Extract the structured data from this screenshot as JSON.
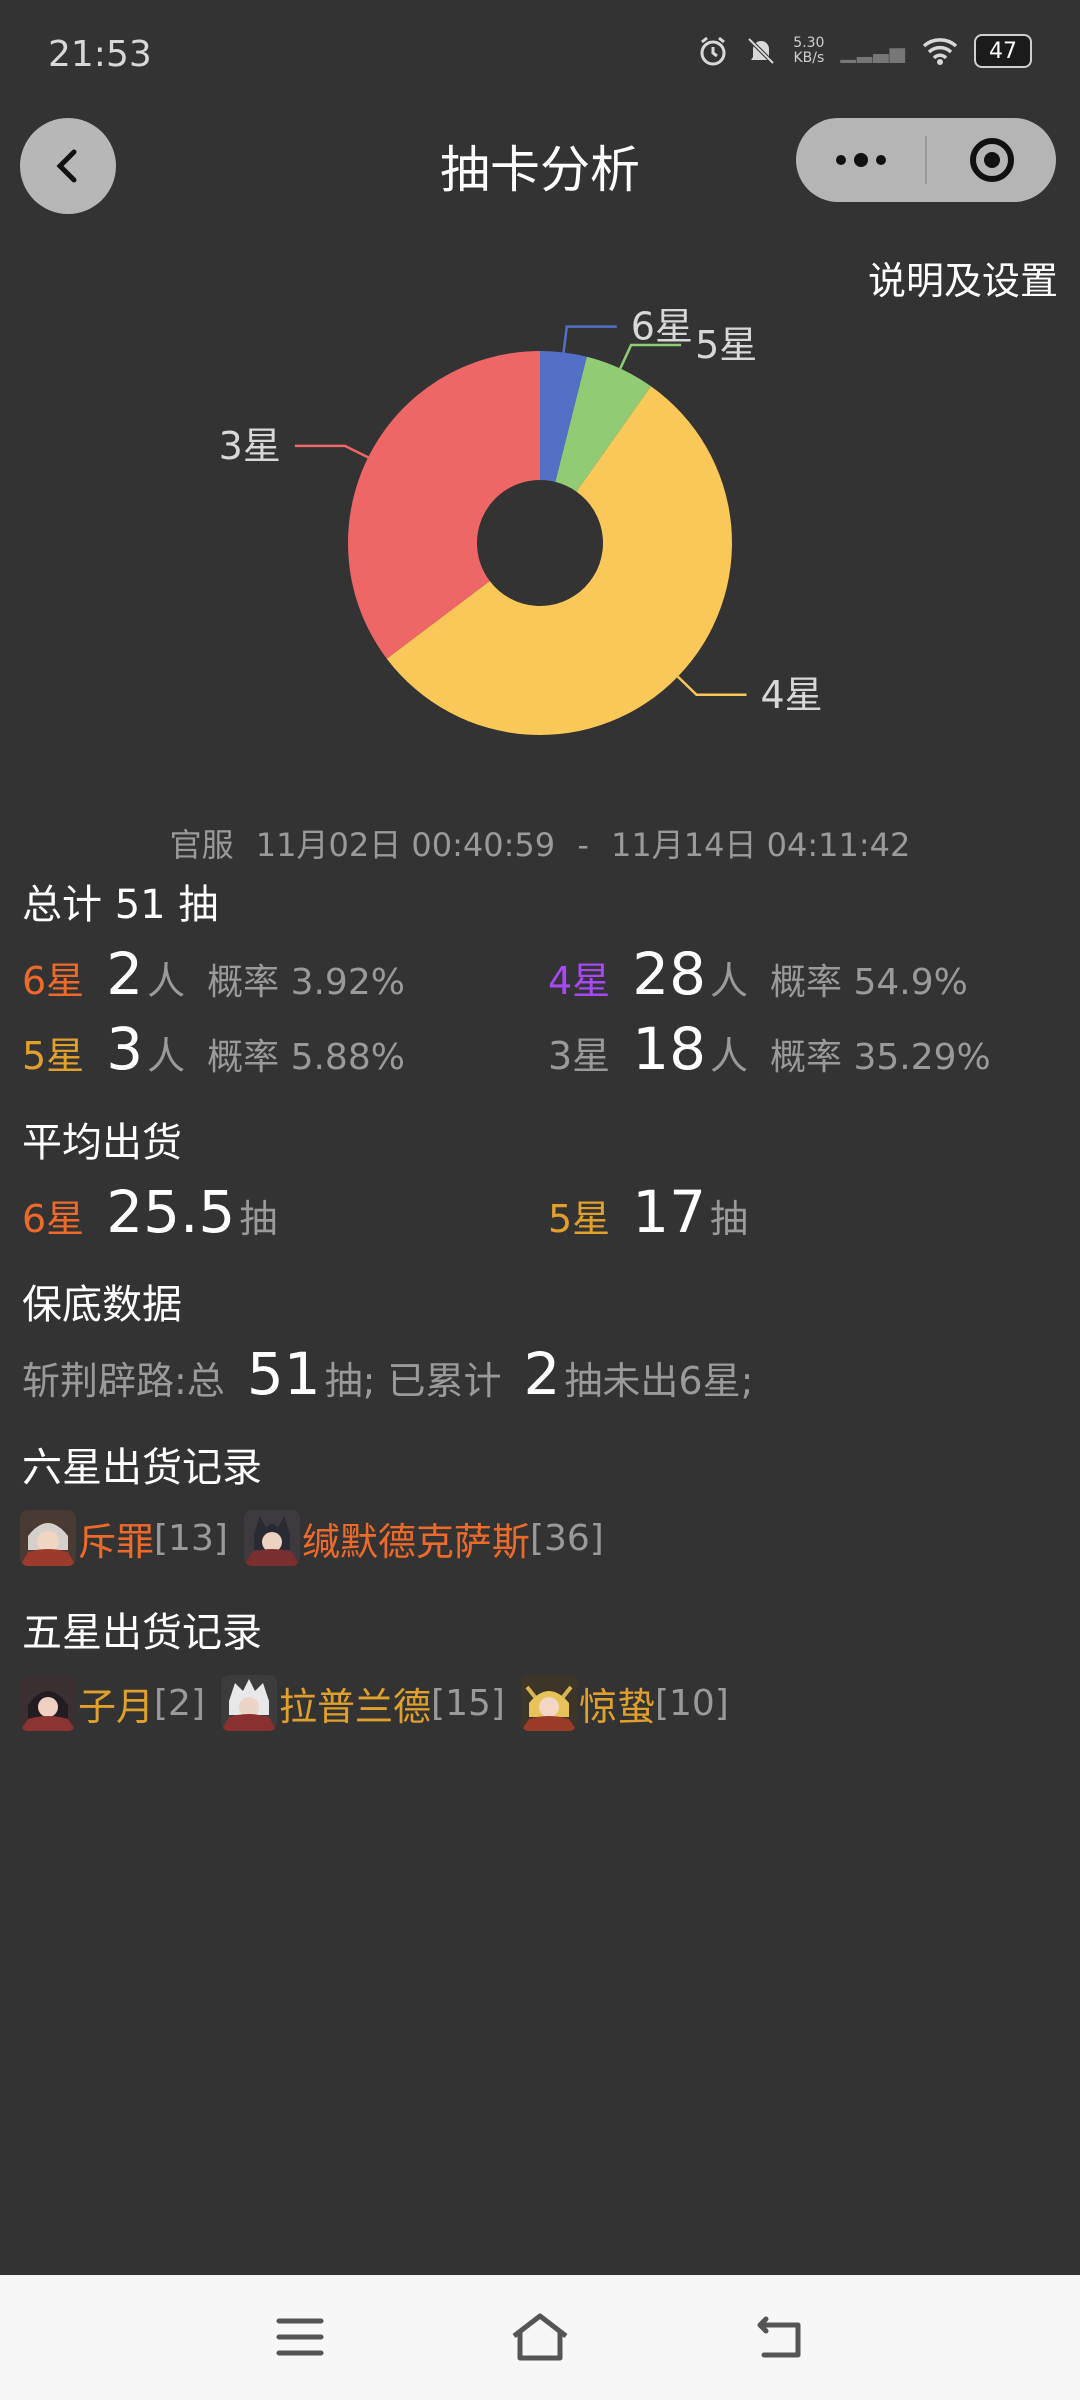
{
  "status_bar": {
    "time": "21:53",
    "net_speed_value": "5.30",
    "net_speed_unit": "KB/s",
    "battery": "47"
  },
  "nav": {
    "title": "抽卡分析"
  },
  "settings_link": "说明及设置",
  "chart_data": {
    "type": "pie",
    "style": "donut",
    "categories": [
      "6星",
      "5星",
      "4星",
      "3星"
    ],
    "values": [
      2,
      3,
      28,
      18
    ],
    "colors": [
      "#5470c6",
      "#91cc75",
      "#fac858",
      "#ee6666"
    ],
    "legend": "none"
  },
  "range": {
    "server": "官服",
    "start": "11月02日 00:40:59",
    "separator": "-",
    "end": "11月14日 04:11:42"
  },
  "summary": {
    "title": "总计 51 抽",
    "unit_person": "人",
    "rate_label": "概率",
    "items": [
      {
        "star": "6星",
        "count": "2",
        "rate": "3.92%"
      },
      {
        "star": "4星",
        "count": "28",
        "rate": "54.9%"
      },
      {
        "star": "5星",
        "count": "3",
        "rate": "5.88%"
      },
      {
        "star": "3星",
        "count": "18",
        "rate": "35.29%"
      }
    ]
  },
  "average": {
    "title": "平均出货",
    "unit": "抽",
    "items": [
      {
        "star": "6星",
        "value": "25.5"
      },
      {
        "star": "5星",
        "value": "17"
      }
    ]
  },
  "pity": {
    "title": "保底数据",
    "pool": "斩荆辟路:总",
    "total": "51",
    "mid_text": "抽; 已累计",
    "accumulated": "2",
    "tail_text": "抽未出6星;"
  },
  "six_star_records": {
    "title": "六星出货记录",
    "items": [
      {
        "name": "斥罪",
        "count": "[13]"
      },
      {
        "name": "缄默德克萨斯",
        "count": "[36]"
      }
    ]
  },
  "five_star_records": {
    "title": "五星出货记录",
    "items": [
      {
        "name": "子月",
        "count": "[2]"
      },
      {
        "name": "拉普兰德",
        "count": "[15]"
      },
      {
        "name": "惊蛰",
        "count": "[10]"
      }
    ]
  },
  "colors": {
    "background": "#333333",
    "six_star": "#ee6a2a",
    "five_star": "#e0a02c",
    "four_star": "#a648f5",
    "three_star": "#9a9a9a"
  }
}
